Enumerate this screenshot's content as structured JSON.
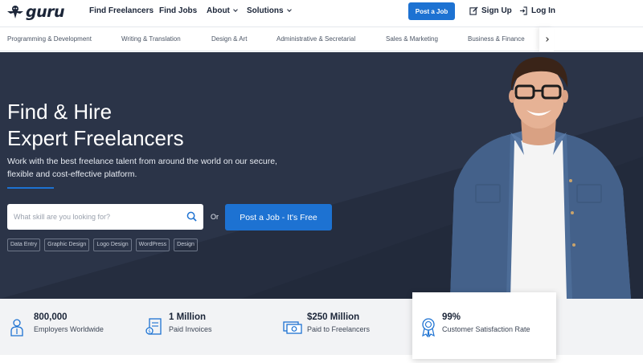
{
  "nav": {
    "logo_text": "guru",
    "links": [
      "Find Freelancers",
      "Find Jobs",
      "About",
      "Solutions"
    ],
    "post_job": "Post a Job",
    "sign_up": "Sign Up",
    "log_in": "Log In"
  },
  "categories": [
    "Programming & Development",
    "Writing & Translation",
    "Design & Art",
    "Administrative & Secretarial",
    "Sales & Marketing",
    "Business & Finance"
  ],
  "hero": {
    "title_line1": "Find & Hire",
    "title_line2": "Expert Freelancers",
    "subtitle": "Work with the best freelance talent from around the world on our secure, flexible and cost-effective platform.",
    "search_placeholder": "What skill are you looking for?",
    "or_text": "Or",
    "post_button": "Post a Job - It's Free",
    "tags": [
      "Data Entry",
      "Graphic Design",
      "Logo Design",
      "WordPress",
      "Design"
    ]
  },
  "stats": [
    {
      "number": "800,000",
      "label": "Employers Worldwide",
      "icon": "employer-icon"
    },
    {
      "number": "1 Million",
      "label": "Paid Invoices",
      "icon": "invoice-icon"
    },
    {
      "number": "$250 Million",
      "label": "Paid to Freelancers",
      "icon": "money-icon"
    },
    {
      "number": "99%",
      "label": "Customer Satisfaction Rate",
      "icon": "award-icon"
    }
  ],
  "colors": {
    "brand_blue": "#1d72d2",
    "hero_bg": "#2b3448",
    "text_dark": "#1b2538"
  }
}
